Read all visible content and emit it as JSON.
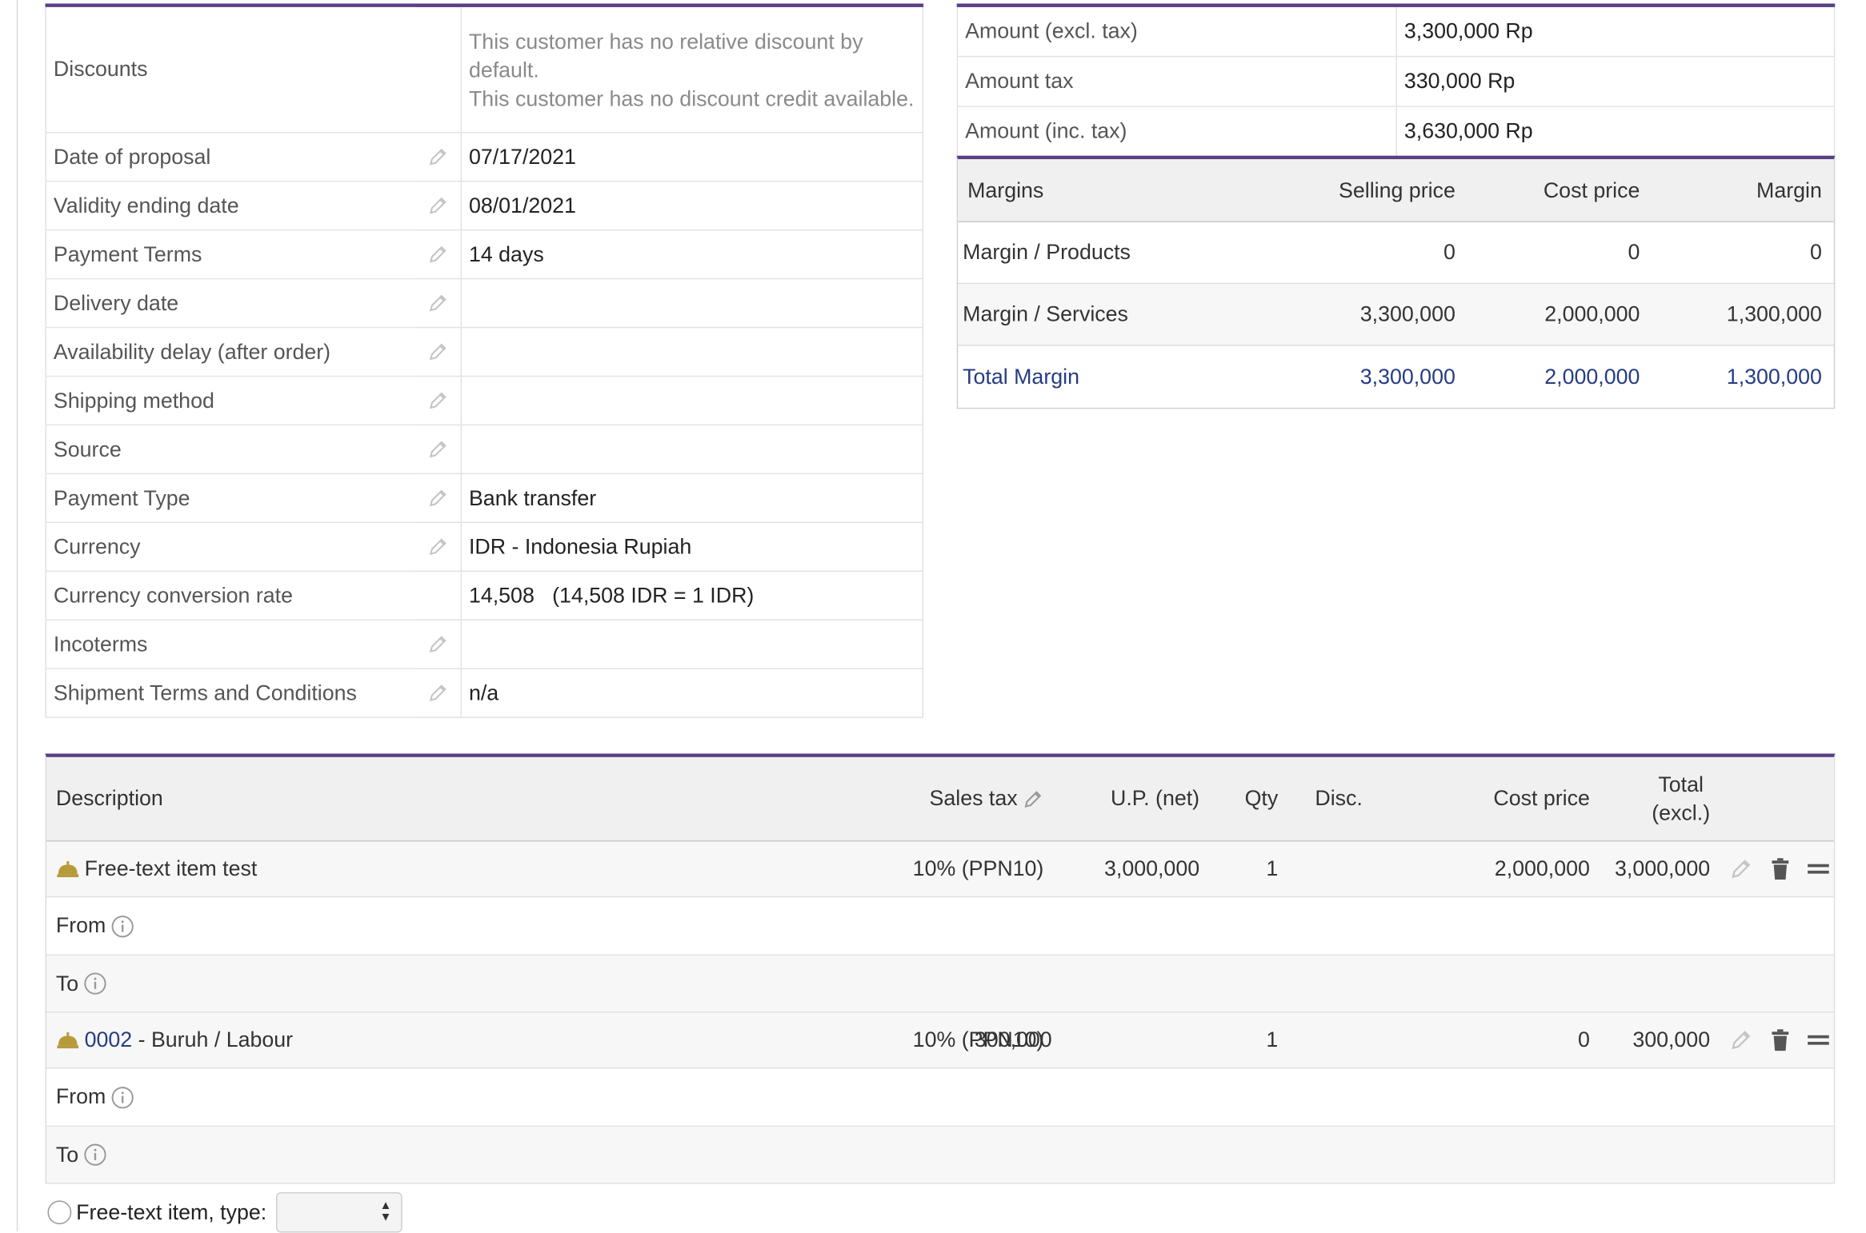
{
  "fields": [
    {
      "label": "Discounts",
      "editable": false,
      "value_lines": [
        "This customer has no relative discount by default.",
        "This customer has no discount credit available."
      ]
    },
    {
      "label": "Date of proposal",
      "editable": true,
      "value": "07/17/2021"
    },
    {
      "label": "Validity ending date",
      "editable": true,
      "value": "08/01/2021"
    },
    {
      "label": "Payment Terms",
      "editable": true,
      "value": "14 days"
    },
    {
      "label": "Delivery date",
      "editable": true,
      "value": ""
    },
    {
      "label": "Availability delay (after order)",
      "editable": true,
      "value": ""
    },
    {
      "label": "Shipping method",
      "editable": true,
      "value": ""
    },
    {
      "label": "Source",
      "editable": true,
      "value": ""
    },
    {
      "label": "Payment Type",
      "editable": true,
      "value": "Bank transfer"
    },
    {
      "label": "Currency",
      "editable": true,
      "value": "IDR - Indonesia Rupiah"
    },
    {
      "label": "Currency conversion rate",
      "editable": false,
      "value": "14,508   (14,508 IDR = 1 IDR)"
    },
    {
      "label": "Incoterms",
      "editable": true,
      "value": ""
    },
    {
      "label": "Shipment Terms and Conditions",
      "editable": true,
      "value": "n/a"
    }
  ],
  "amounts": [
    {
      "label": "Amount (excl. tax)",
      "value": "3,300,000 Rp"
    },
    {
      "label": "Amount tax",
      "value": "330,000 Rp"
    },
    {
      "label": "Amount (inc. tax)",
      "value": "3,630,000 Rp"
    }
  ],
  "margins": {
    "headers": [
      "Margins",
      "Selling price",
      "Cost price",
      "Margin"
    ],
    "rows": [
      [
        "Margin / Products",
        "0",
        "0",
        "0"
      ],
      [
        "Margin / Services",
        "3,300,000",
        "2,000,000",
        "1,300,000"
      ],
      [
        "Total Margin",
        "3,300,000",
        "2,000,000",
        "1,300,000"
      ]
    ]
  },
  "lines": {
    "headers": {
      "description": "Description",
      "sales_tax": "Sales tax",
      "up_net": "U.P. (net)",
      "qty": "Qty",
      "disc": "Disc.",
      "cost_price": "Cost price",
      "total_line1": "Total",
      "total_line2": "(excl.)"
    },
    "items": [
      {
        "ref": "",
        "sep": "",
        "description": "Free-text item test",
        "sales_tax": "10% (PPN10)",
        "up_net": "3,000,000",
        "qty": "1",
        "disc": "",
        "cost_price": "2,000,000",
        "total": "3,000,000",
        "from_label": "From",
        "to_label": "To"
      },
      {
        "ref": "0002",
        "sep": " - ",
        "description": "Buruh / Labour",
        "sales_tax": "10% (PPN10)",
        "up_net": "300,000",
        "qty": "1",
        "disc": "",
        "cost_price": "0",
        "total": "300,000",
        "from_label": "From",
        "to_label": "To"
      }
    ],
    "freetext_label": "Free-text item, type:",
    "freetext_selected": ""
  },
  "colors": {
    "accent": "#5a3f85",
    "link": "#263c81",
    "bell": "#b79a3a"
  }
}
